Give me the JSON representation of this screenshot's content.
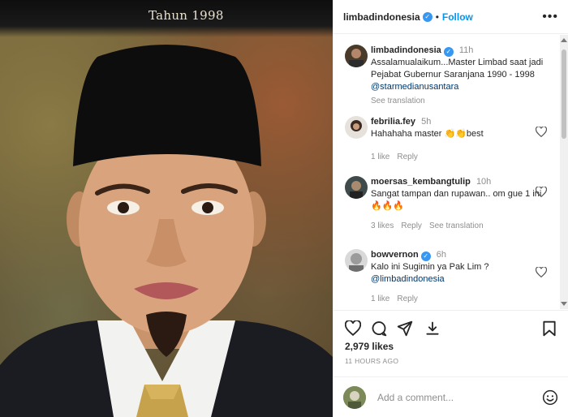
{
  "photo": {
    "caption_overlay": "Tahun 1998"
  },
  "header": {
    "username": "limbadindonesia",
    "follow_label": "Follow",
    "more_label": "•••"
  },
  "comments": [
    {
      "user": "limbadindonesia",
      "verified": true,
      "time": "11h",
      "text": "Assalamualaikum...Master Limbad saat jadi Pejabat Gubernur Saranjana 1990 - 1998 ",
      "mention": "@starmedianusantara",
      "action": "See translation"
    },
    {
      "user": "febrilia.fey",
      "time": "5h",
      "text": "Hahahaha master 👏👏best",
      "likes": "1 like",
      "reply": "Reply"
    },
    {
      "user": "moersas_kembangtulip",
      "time": "10h",
      "text": "Sangat tampan dan rupawan.. om gue 1 ini 🔥🔥🔥",
      "likes": "3 likes",
      "reply": "Reply",
      "translate": "See translation"
    },
    {
      "user": "bowvernon",
      "verified": true,
      "time": "6h",
      "text": "Kalo ini Sugimin ya Pak Lim ? ",
      "mention": "@limbadindonesia",
      "likes": "1 like",
      "reply": "Reply"
    }
  ],
  "stats": {
    "likes": "2,979 likes",
    "time_ago": "11 HOURS AGO"
  },
  "composer": {
    "placeholder": "Add a comment..."
  },
  "colors": {
    "accent": "#0095f6",
    "verified": "#3897f0",
    "muted": "#8e8e8e"
  },
  "icons": [
    "more-icon",
    "heart-icon",
    "comment-icon",
    "share-icon",
    "save-icon",
    "bookmark-icon",
    "emoji-icon"
  ]
}
